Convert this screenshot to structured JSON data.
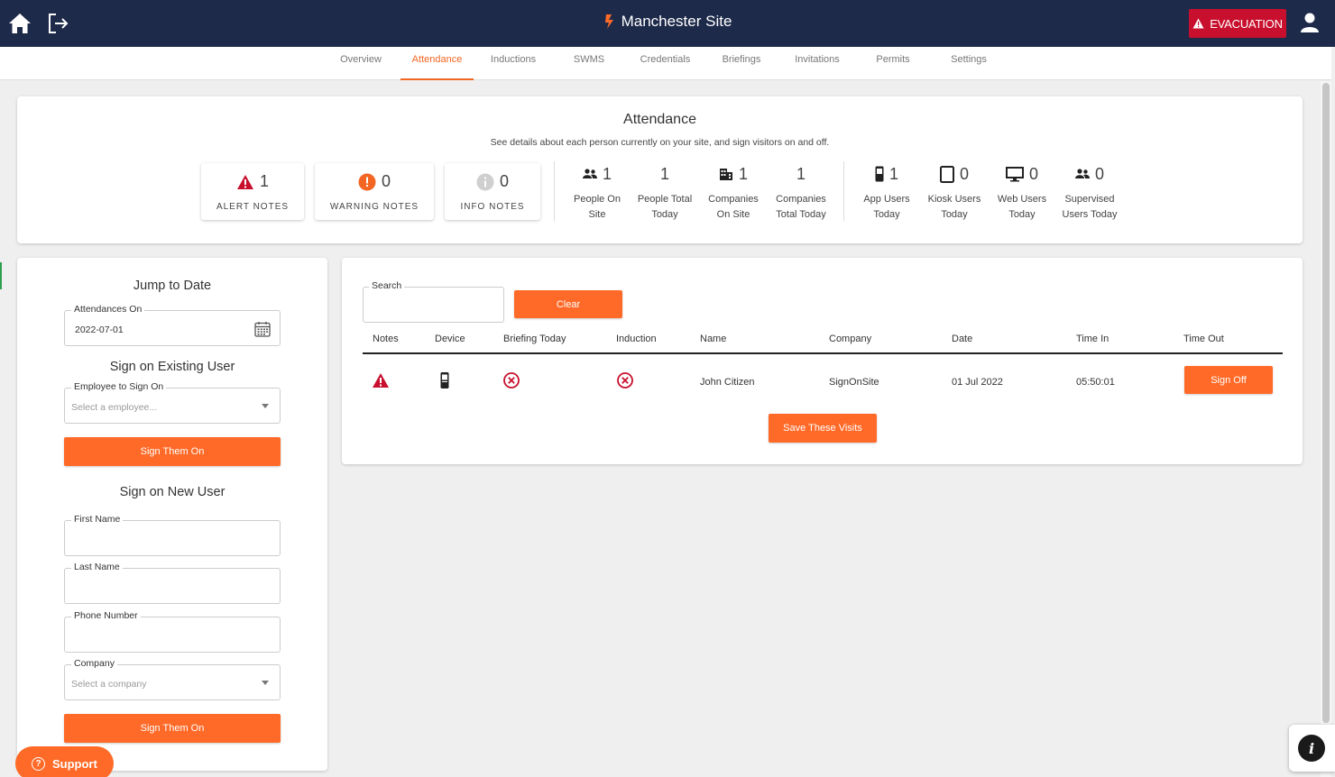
{
  "header": {
    "title": "Manchester Site",
    "evacuation_label": "EVACUATION",
    "icons": {
      "home": "home-icon",
      "logout": "logout-icon",
      "logo": "logo-icon",
      "user": "user-icon"
    }
  },
  "tabs": [
    {
      "label": "Overview"
    },
    {
      "label": "Attendance",
      "active": true
    },
    {
      "label": "Inductions"
    },
    {
      "label": "SWMS"
    },
    {
      "label": "Credentials"
    },
    {
      "label": "Briefings"
    },
    {
      "label": "Invitations"
    },
    {
      "label": "Permits"
    },
    {
      "label": "Settings"
    }
  ],
  "summary": {
    "title": "Attendance",
    "subtitle": "See details about each person currently on your site, and sign visitors on and off.",
    "notes": [
      {
        "value": "1",
        "label": "ALERT NOTES",
        "icon": "alert-triangle-icon"
      },
      {
        "value": "0",
        "label": "WARNING NOTES",
        "icon": "warning-circle-icon"
      },
      {
        "value": "0",
        "label": "INFO NOTES",
        "icon": "info-circle-icon"
      }
    ],
    "stats": [
      {
        "value": "1",
        "label1": "People On",
        "label2": "Site",
        "icon": "people-icon"
      },
      {
        "value": "1",
        "label1": "People Total",
        "label2": "Today"
      },
      {
        "value": "1",
        "label1": "Companies",
        "label2": "On Site",
        "icon": "building-icon"
      },
      {
        "value": "1",
        "label1": "Companies",
        "label2": "Total Today"
      },
      {
        "value": "1",
        "label1": "App Users",
        "label2": "Today",
        "icon": "mobile-phone-icon"
      },
      {
        "value": "0",
        "label1": "Kiosk Users",
        "label2": "Today",
        "icon": "tablet-icon"
      },
      {
        "value": "0",
        "label1": "Web Users",
        "label2": "Today",
        "icon": "monitor-icon"
      },
      {
        "value": "0",
        "label1": "Supervised",
        "label2": "Users Today",
        "icon": "people-icon"
      }
    ]
  },
  "jump": {
    "title": "Jump to Date",
    "date_label": "Attendances On",
    "date_value": "2022-07-01"
  },
  "existing": {
    "title": "Sign on Existing User",
    "employee_label": "Employee to Sign On",
    "employee_placeholder": "Select a employee...",
    "button": "Sign Them On"
  },
  "new_user": {
    "title": "Sign on New User",
    "first_name_label": "First Name",
    "last_name_label": "Last Name",
    "phone_label": "Phone Number",
    "company_label": "Company",
    "company_placeholder": "Select a company",
    "button": "Sign Them On"
  },
  "table": {
    "search_label": "Search",
    "clear_label": "Clear",
    "columns": [
      "Notes",
      "Device",
      "Briefing Today",
      "Induction",
      "Name",
      "Company",
      "Date",
      "Time In",
      "Time Out"
    ],
    "rows": [
      {
        "name": "John Citizen",
        "company": "SignOnSite",
        "date": "01 Jul 2022",
        "time_in": "05:50:01",
        "sign_off_label": "Sign Off"
      }
    ],
    "save_label": "Save These Visits"
  },
  "support": {
    "label": "Support"
  },
  "colors": {
    "accent": "#ff6a28",
    "navbar": "#1d2a4a",
    "evacuation": "#c8102e",
    "alert": "#c8102e"
  }
}
